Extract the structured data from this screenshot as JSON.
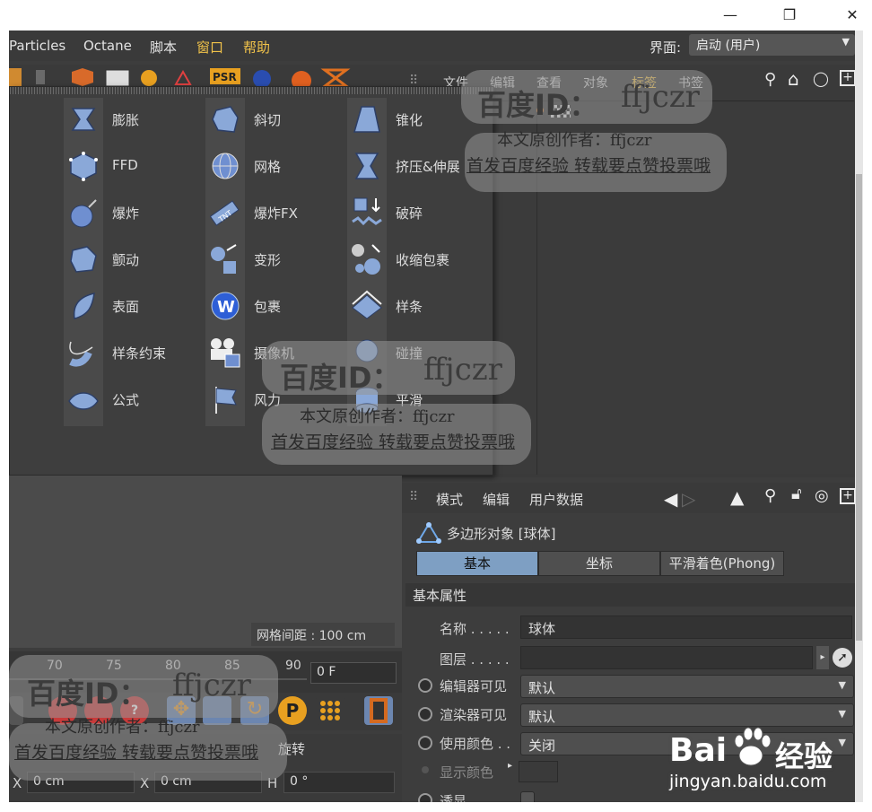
{
  "window": {
    "restore_glyph": "❐",
    "minimize_glyph": "—",
    "close_glyph": "✕"
  },
  "menubar": {
    "items": [
      "Particles",
      "Octane",
      "脚本",
      "窗口",
      "帮助"
    ],
    "layout_label": "界面:",
    "layout_value": "启动 (用户)"
  },
  "object_manager": {
    "tabs": [
      "文件",
      "编辑",
      "查看",
      "对象",
      "标签",
      "书签"
    ]
  },
  "deformer_menu": {
    "col1": [
      "膨胀",
      "FFD",
      "爆炸",
      "颤动",
      "表面",
      "样条约束",
      "公式"
    ],
    "col2": [
      "斜切",
      "网格",
      "爆炸FX",
      "变形",
      "包裹",
      "摄像机",
      "风力"
    ],
    "col3": [
      "锥化",
      "挤压&伸展",
      "破碎",
      "收缩包裹",
      "样条",
      "碰撞",
      "平滑"
    ]
  },
  "viewport": {
    "grid_spacing": "网格间距 : 100 cm"
  },
  "timeline": {
    "ticks": [
      "70",
      "75",
      "80",
      "85",
      "90"
    ],
    "frame": "0 F"
  },
  "coordinates": {
    "section": "旋转",
    "x_label": "X",
    "x_value": "0 cm",
    "x2_label": "X",
    "x2_value": "0 cm",
    "h_label": "H",
    "h_value": "0 °"
  },
  "attributes": {
    "tabs": [
      "模式",
      "编辑",
      "用户数据"
    ],
    "object_title": "多边形对象 [球体]",
    "subtabs": [
      "基本",
      "坐标",
      "平滑着色(Phong)"
    ],
    "section": "基本属性",
    "rows": {
      "name_label": "名称 . . . . .",
      "name_value": "球体",
      "layer_label": "图层 . . . . .",
      "editor_vis_label": "编辑器可见",
      "editor_vis_value": "默认",
      "render_vis_label": "渲染器可见",
      "render_vis_value": "默认",
      "use_color_label": "使用颜色 . .",
      "use_color_value": "关闭",
      "display_color_label": "显示颜色",
      "xray_label": "透显 . . . . ."
    }
  },
  "watermark": {
    "id_line": "百度ID：ffjczr",
    "big": "百度ID：",
    "id": "ffjczr",
    "author": "本文原创作者：ffjczr",
    "promo": "首发百度经验 转载要点赞投票哦"
  },
  "logo": {
    "brand": "Bai",
    "brand2": "经验",
    "url": "jingyan.baidu.com"
  },
  "colors": {
    "accent": "#f0c24a",
    "active_tab": "#7e9fc3",
    "panel": "#3d3d3d"
  }
}
